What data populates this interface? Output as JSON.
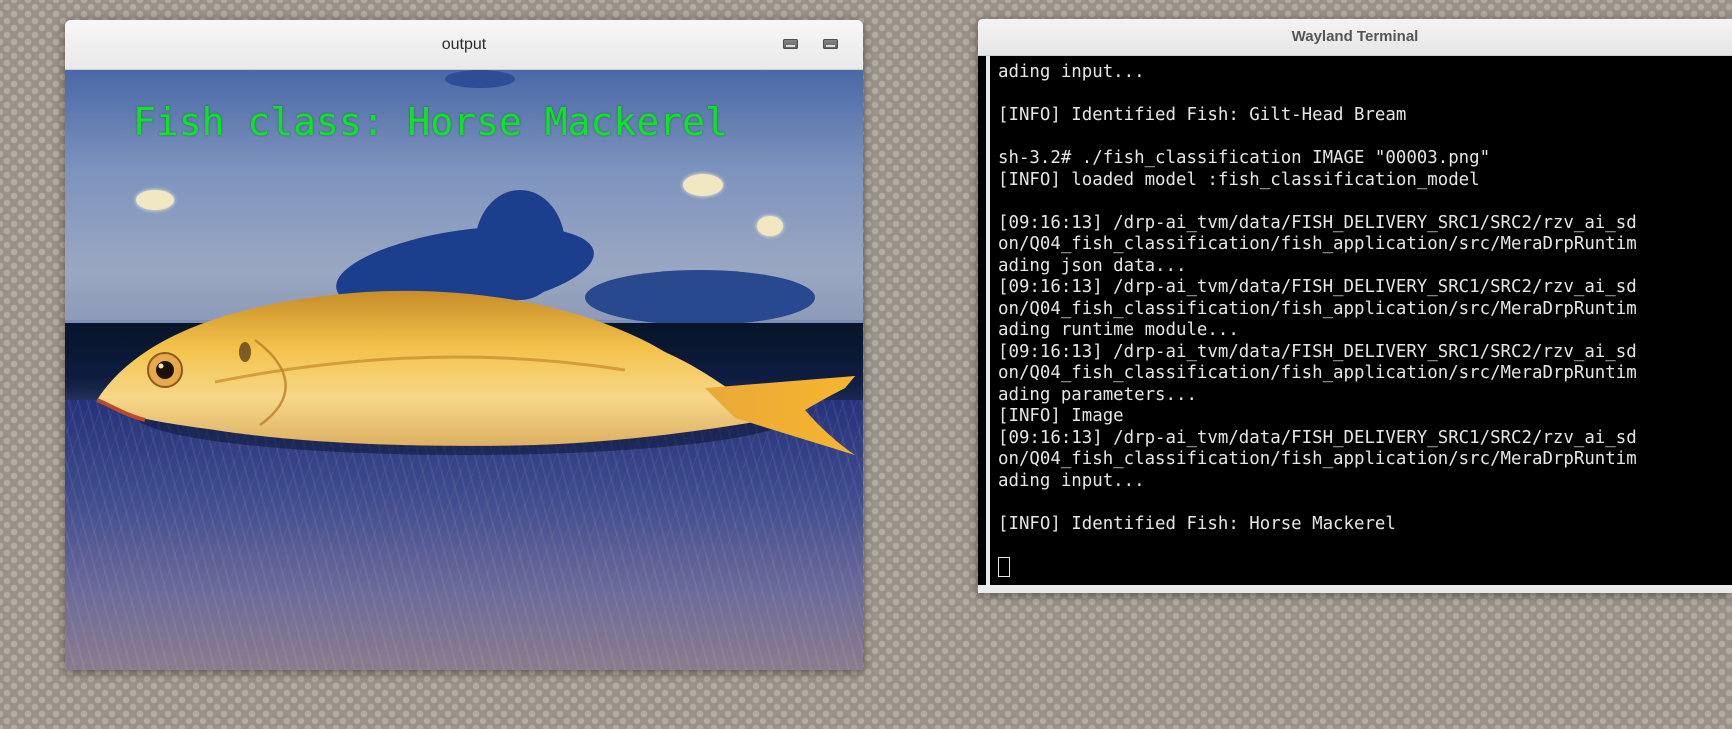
{
  "output_window": {
    "title": "output",
    "overlay_label": "Fish class: Horse Mackerel",
    "overlay_color": "#10e22a",
    "buttons": [
      "minimize-icon",
      "maximize-icon"
    ]
  },
  "terminal_window": {
    "title": "Wayland Terminal",
    "lines": [
      "ading input...",
      "",
      "[INFO] Identified Fish: Gilt-Head Bream",
      "",
      "sh-3.2# ./fish_classification IMAGE \"00003.png\"",
      "[INFO] loaded model :fish_classification_model",
      "",
      "[09:16:13] /drp-ai_tvm/data/FISH_DELIVERY_SRC1/SRC2/rzv_ai_sd",
      "on/Q04_fish_classification/fish_application/src/MeraDrpRuntim",
      "ading json data...",
      "[09:16:13] /drp-ai_tvm/data/FISH_DELIVERY_SRC1/SRC2/rzv_ai_sd",
      "on/Q04_fish_classification/fish_application/src/MeraDrpRuntim",
      "ading runtime module...",
      "[09:16:13] /drp-ai_tvm/data/FISH_DELIVERY_SRC1/SRC2/rzv_ai_sd",
      "on/Q04_fish_classification/fish_application/src/MeraDrpRuntim",
      "ading parameters...",
      "[INFO] Image",
      "[09:16:13] /drp-ai_tvm/data/FISH_DELIVERY_SRC1/SRC2/rzv_ai_sd",
      "on/Q04_fish_classification/fish_application/src/MeraDrpRuntim",
      "ading input...",
      "",
      "[INFO] Identified Fish: Horse Mackerel",
      ""
    ]
  }
}
